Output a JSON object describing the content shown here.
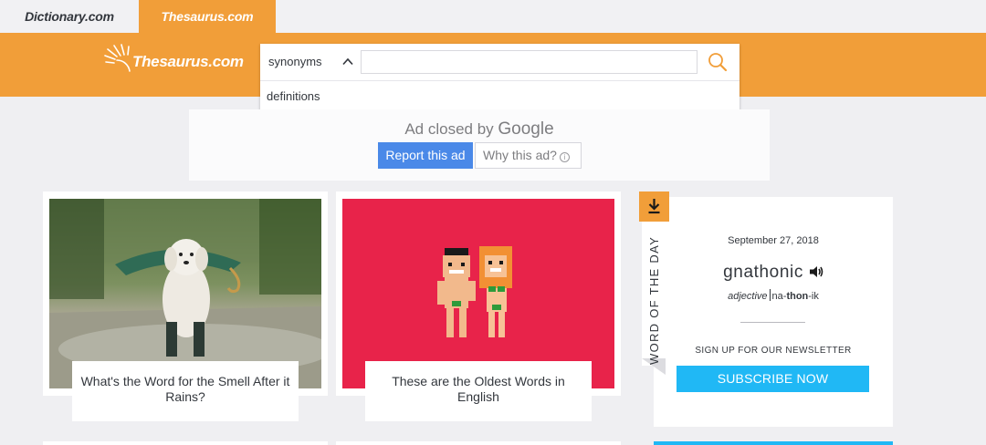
{
  "site_tabs": [
    {
      "label": "Dictionary.com",
      "active": false
    },
    {
      "label": "Thesaurus.com",
      "active": true
    }
  ],
  "header": {
    "logo_text": "Thesaurus.com",
    "brand_color": "#f19e39"
  },
  "search": {
    "selected_option": "synonyms",
    "dropdown_options": [
      "definitions"
    ],
    "input_value": "",
    "button_icon": "search-icon"
  },
  "ad": {
    "closed_text": "Ad closed by ",
    "brand": "Google",
    "report_label": "Report this ad",
    "why_label": "Why this ad?",
    "info_icon": "info-icon"
  },
  "cards": [
    {
      "caption": "What's the Word for the Smell After it Rains?",
      "image": "dog-with-umbrella-in-rain"
    },
    {
      "caption": "These are the Oldest Words in English",
      "image": "pixel-adam-and-eve"
    }
  ],
  "word_of_the_day": {
    "label": "WORD OF THE DAY",
    "date": "September 27, 2018",
    "word": "gnathonic",
    "part_of_speech": "adjective",
    "pron_pre": "na-",
    "pron_stress": "thon",
    "pron_post": "-ik",
    "newsletter_label": "SIGN UP FOR OUR NEWSLETTER",
    "subscribe_label": "SUBSCRIBE NOW",
    "subscribe_color": "#20b8f5"
  }
}
